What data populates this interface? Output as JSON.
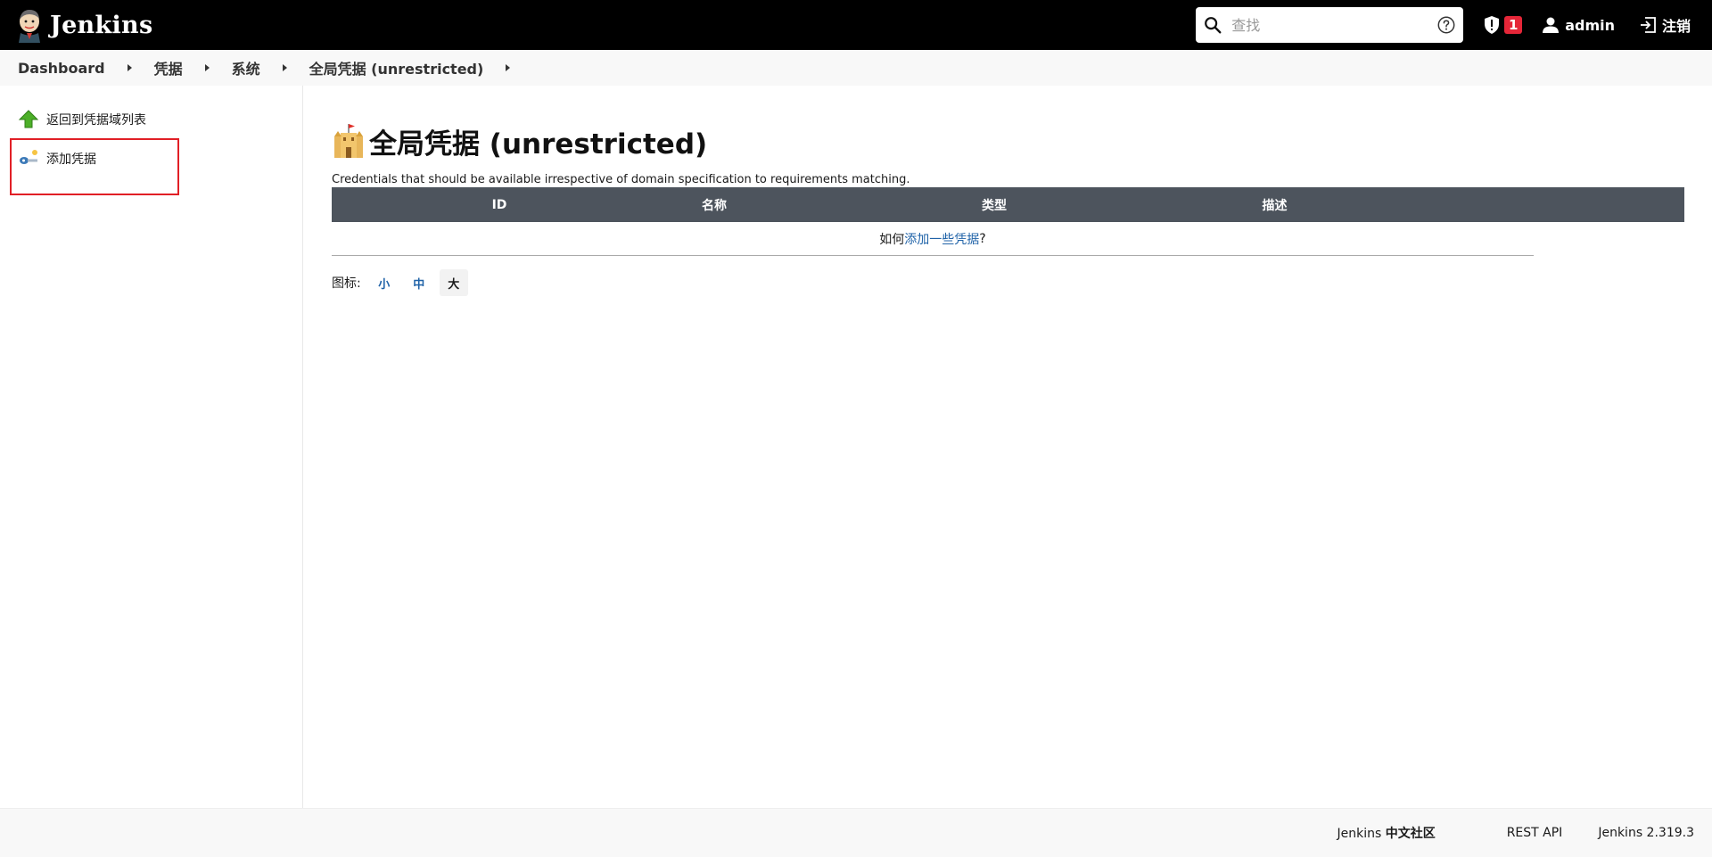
{
  "header": {
    "brand": "Jenkins",
    "search_placeholder": "查找",
    "security_count": "1",
    "user": "admin",
    "logout": "注销"
  },
  "breadcrumb": [
    "Dashboard",
    "凭据",
    "系统",
    "全局凭据 (unrestricted)"
  ],
  "side_panel": {
    "tasks": [
      {
        "label": "返回到凭据域列表",
        "icon": "green-up-arrow-icon"
      },
      {
        "label": "添加凭据",
        "icon": "credentials-key-icon"
      }
    ]
  },
  "main": {
    "title": "全局凭据 (unrestricted)",
    "description": "Credentials that should be available irrespective of domain specification to requirements matching.",
    "table": {
      "columns": [
        "ID",
        "名称",
        "类型",
        "描述"
      ],
      "empty_prefix": "如何",
      "empty_link": "添加一些凭据",
      "empty_suffix": "?"
    },
    "icon_size": {
      "label": "图标:",
      "options": [
        "小",
        "中",
        "大"
      ],
      "selected": "大"
    }
  },
  "footer": {
    "community_prefix": "Jenkins ",
    "community_bold": "中文社区",
    "rest_api": "REST API",
    "version": "Jenkins 2.319.3"
  },
  "colors": {
    "header_bg": "#000000",
    "table_header_bg": "#4d545d",
    "link": "#2063a8",
    "badge": "#e52638",
    "highlight": "#e11f26"
  }
}
